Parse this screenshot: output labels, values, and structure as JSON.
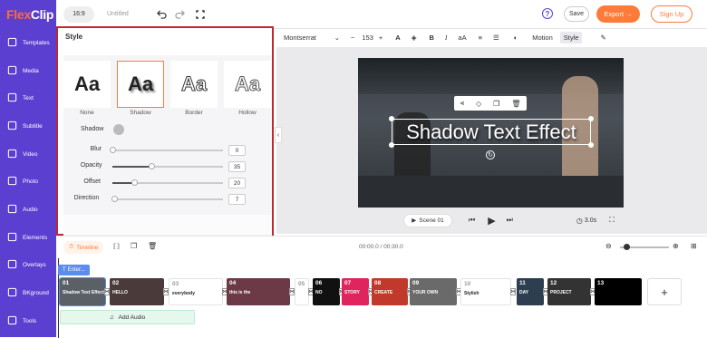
{
  "app": {
    "logo_flex": "Flex",
    "logo_clip": "Clip"
  },
  "sidebar": {
    "items": [
      {
        "label": "Templates",
        "icon": "templates-icon"
      },
      {
        "label": "Media",
        "icon": "media-icon"
      },
      {
        "label": "Text",
        "icon": "text-icon"
      },
      {
        "label": "Subtitle",
        "icon": "subtitle-icon"
      },
      {
        "label": "Video",
        "icon": "video-icon"
      },
      {
        "label": "Photo",
        "icon": "photo-icon"
      },
      {
        "label": "Audio",
        "icon": "audio-icon"
      },
      {
        "label": "Elements",
        "icon": "elements-icon"
      },
      {
        "label": "Overlays",
        "icon": "overlays-icon"
      },
      {
        "label": "BKground",
        "icon": "background-icon"
      },
      {
        "label": "Tools",
        "icon": "tools-icon"
      }
    ]
  },
  "topbar": {
    "ratio": "16:9",
    "title": "Untitled",
    "save": "Save",
    "export": "Export →",
    "signup": "Sign Up",
    "help": "?"
  },
  "text_toolbar": {
    "font": "Montserrat",
    "size": "153",
    "minus": "−",
    "plus": "+",
    "motion": "Motion",
    "style": "Style"
  },
  "style_panel": {
    "title": "Style",
    "options": [
      {
        "label": "None",
        "sample": "Aa"
      },
      {
        "label": "Shadow",
        "sample": "Aa"
      },
      {
        "label": "Border",
        "sample": "Aa"
      },
      {
        "label": "Hollow",
        "sample": "Aa"
      }
    ],
    "shadow_label": "Shadow",
    "props": [
      {
        "label": "Blur",
        "value": "0",
        "level": 0
      },
      {
        "label": "Opacity",
        "value": "35",
        "level": 0.35
      },
      {
        "label": "Offset",
        "value": "20",
        "level": 0.2
      },
      {
        "label": "Direction",
        "value": "7",
        "level": 0.02
      }
    ]
  },
  "canvas": {
    "text": "Shadow Text Effect"
  },
  "player": {
    "scene": "Scene 01",
    "duration": "3.0s"
  },
  "timeline": {
    "tab": "Timeline",
    "time": "00:00.0 / 00:30.0",
    "text_track": "Enter...",
    "add_audio": "Add Audio",
    "clips": [
      {
        "num": "01",
        "text": "Shadow Text Effect",
        "color": "#5b5f66"
      },
      {
        "num": "02",
        "text": "HELLO",
        "color": "#4a3a3a"
      },
      {
        "num": "03",
        "text": "everybody",
        "color": "#ffffff"
      },
      {
        "num": "04",
        "text": "this is the",
        "color": "#6b3a46"
      },
      {
        "num": "05",
        "text": "",
        "color": "#ffffff"
      },
      {
        "num": "06",
        "text": "NO",
        "color": "#111111"
      },
      {
        "num": "07",
        "text": "STORY",
        "color": "#e0245e"
      },
      {
        "num": "08",
        "text": "CREATE",
        "color": "#c0392b"
      },
      {
        "num": "09",
        "text": "YOUR OWN",
        "color": "#6a6a6a"
      },
      {
        "num": "10",
        "text": "Stylish",
        "color": "#ffffff"
      },
      {
        "num": "11",
        "text": "DAY",
        "color": "#2c3e50"
      },
      {
        "num": "12",
        "text": "PROJECT",
        "color": "#333333"
      },
      {
        "num": "13",
        "text": "",
        "color": "#000000"
      }
    ]
  }
}
